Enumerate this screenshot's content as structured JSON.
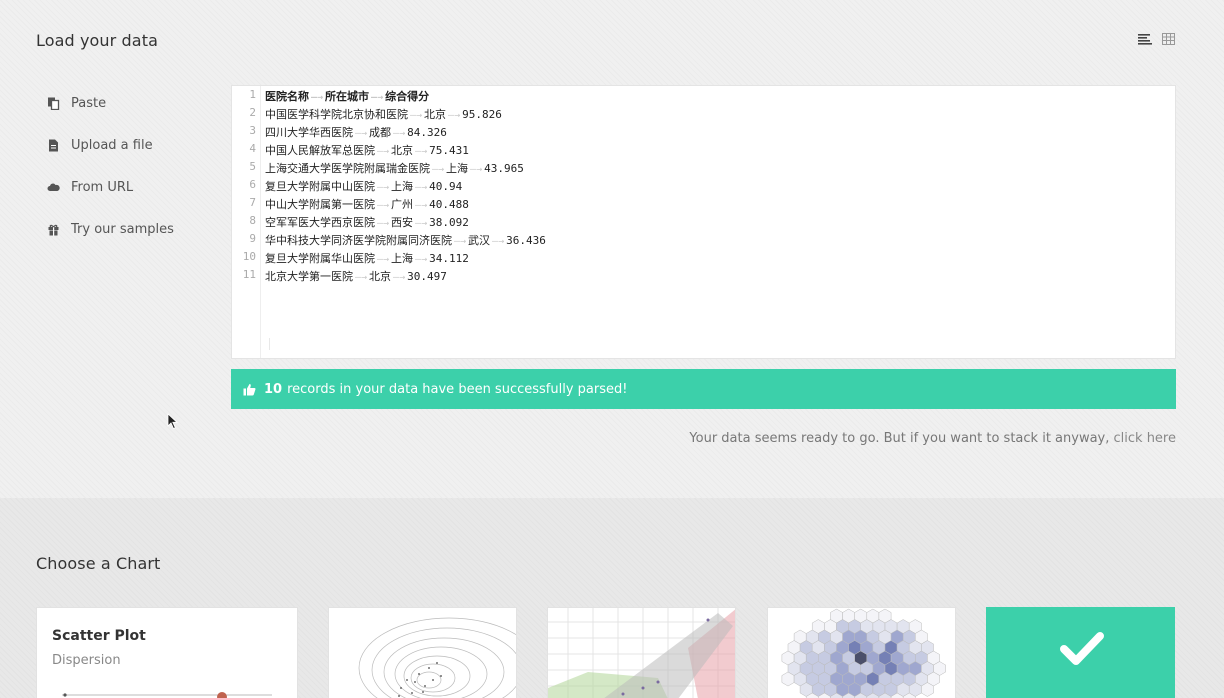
{
  "load_section": {
    "title": "Load your data",
    "view_toggle": {
      "text_view_icon": "align-left-icon",
      "table_view_icon": "table-icon"
    }
  },
  "nav": {
    "items": [
      {
        "label": "Paste",
        "icon": "paste-icon"
      },
      {
        "label": "Upload a file",
        "icon": "file-icon"
      },
      {
        "label": "From URL",
        "icon": "cloud-icon"
      },
      {
        "label": "Try our samples",
        "icon": "gift-icon"
      }
    ]
  },
  "editor": {
    "line_numbers": [
      "1",
      "2",
      "3",
      "4",
      "5",
      "6",
      "7",
      "8",
      "9",
      "10",
      "11"
    ],
    "header": [
      "医院名称",
      "所在城市",
      "综合得分"
    ],
    "rows": [
      [
        "中国医学科学院北京协和医院",
        "北京",
        "95.826"
      ],
      [
        "四川大学华西医院",
        "成都",
        "84.326"
      ],
      [
        "中国人民解放军总医院",
        "北京",
        "75.431"
      ],
      [
        "上海交通大学医学院附属瑞金医院",
        "上海",
        "43.965"
      ],
      [
        "复旦大学附属中山医院",
        "上海",
        "40.94"
      ],
      [
        "中山大学附属第一医院",
        "广州",
        "40.488"
      ],
      [
        "空军军医大学西京医院",
        "西安",
        "38.092"
      ],
      [
        "华中科技大学同济医学院附属同济医院",
        "武汉",
        "36.436"
      ],
      [
        "复旦大学附属华山医院",
        "上海",
        "34.112"
      ],
      [
        "北京大学第一医院",
        "北京",
        "30.497"
      ]
    ]
  },
  "status": {
    "count": "10",
    "message": "records in your data have been successfully parsed!",
    "color": "#3cd0aa"
  },
  "stack_note": {
    "text": "Your data seems ready to go. But if you want to stack it anyway,",
    "link": "click here"
  },
  "chart_section": {
    "title": "Choose a Chart",
    "cards": [
      {
        "title": "Scatter Plot",
        "subtitle": "Dispersion"
      },
      {
        "title": "",
        "subtitle": ""
      },
      {
        "title": "",
        "subtitle": ""
      },
      {
        "title": "",
        "subtitle": ""
      },
      {
        "title": "",
        "subtitle": "",
        "selected": true,
        "icon": "checkmark-icon"
      }
    ]
  }
}
